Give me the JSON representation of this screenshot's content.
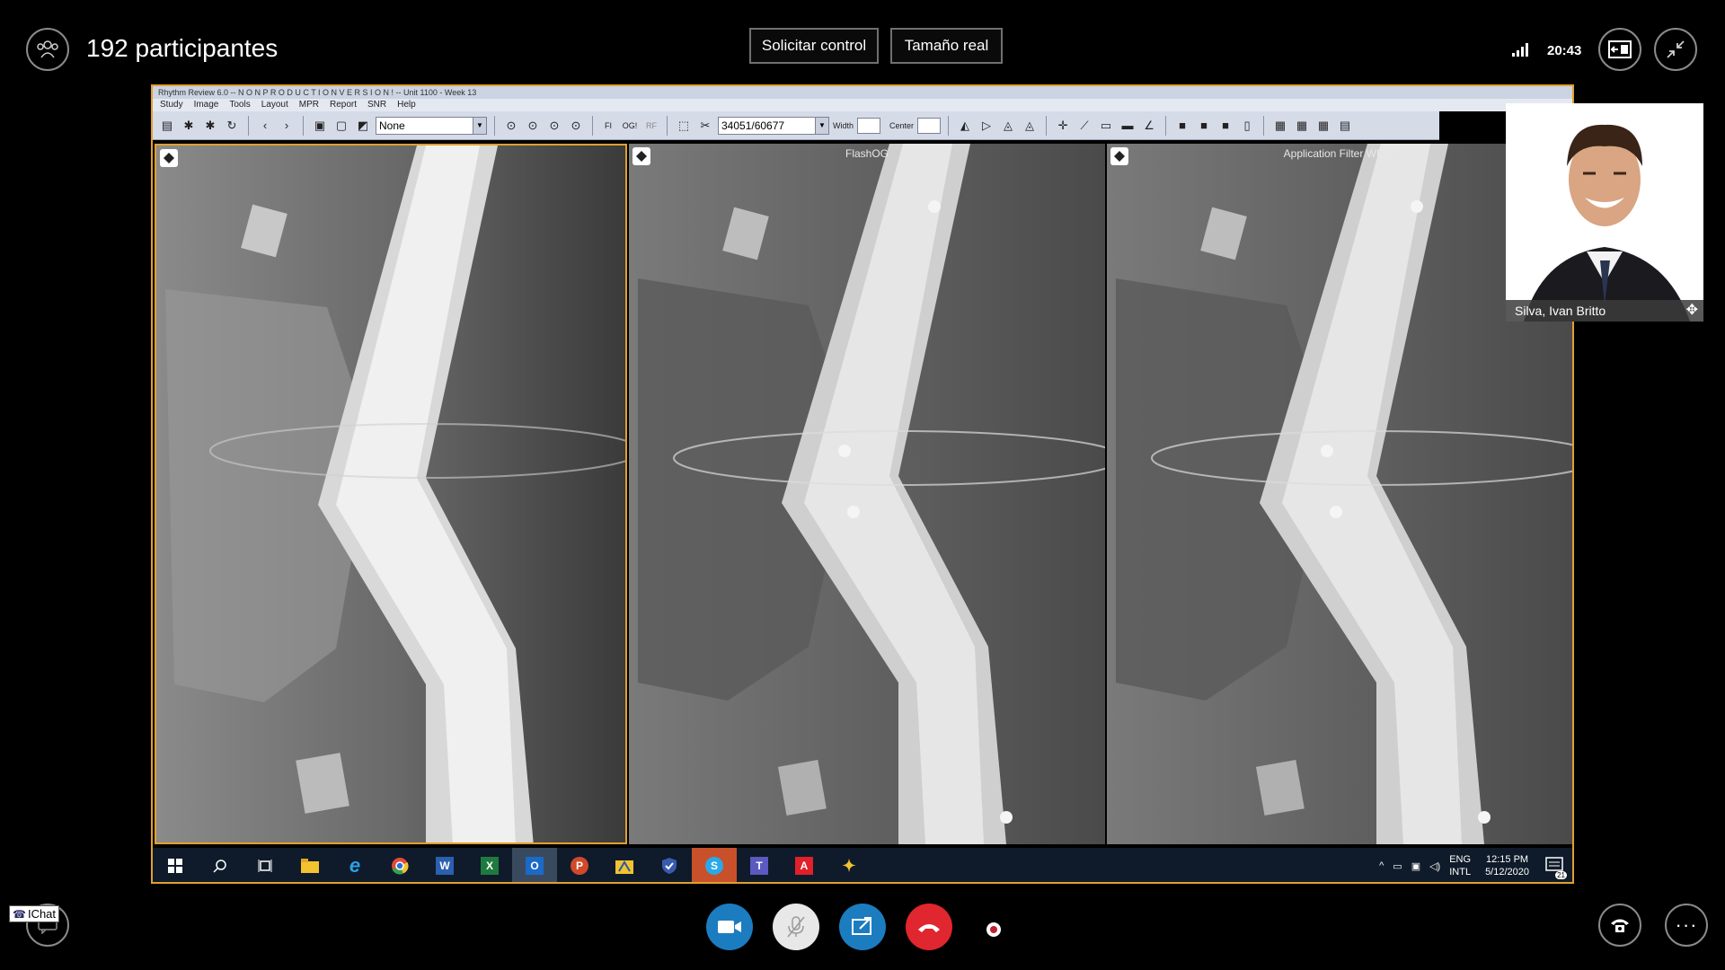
{
  "header": {
    "participants": "192 participantes",
    "request_control": "Solicitar control",
    "actual_size": "Tamaño real",
    "time": "20:43"
  },
  "app": {
    "title": "Rhythm Review 6.0 -- N O N   P R O D U C T I O N   V E R S I O N ! -- Unit 1100 - Week 13",
    "menu": [
      "Study",
      "Image",
      "Tools",
      "Layout",
      "MPR",
      "Report",
      "SNR",
      "Help"
    ],
    "preset_select": "None",
    "filter_labels": [
      "FI",
      "OG!",
      "RF"
    ],
    "image_select": "34051/60677",
    "width_label": "Width",
    "center_label": "Center",
    "panes": [
      {
        "label": ""
      },
      {
        "label": "FlashOG"
      },
      {
        "label": "Application Filter WELD"
      }
    ]
  },
  "taskbar": {
    "apps": [
      {
        "icon": "windows-start-icon",
        "active": false
      },
      {
        "icon": "search-icon",
        "active": false
      },
      {
        "icon": "task-view-icon",
        "active": false
      },
      {
        "icon": "file-explorer-icon",
        "active": false
      },
      {
        "icon": "internet-explorer-icon",
        "active": false
      },
      {
        "icon": "chrome-icon",
        "active": false
      },
      {
        "icon": "word-icon",
        "active": false
      },
      {
        "icon": "excel-icon",
        "active": false
      },
      {
        "icon": "outlook-icon",
        "active": true
      },
      {
        "icon": "powerpoint-icon",
        "active": false
      },
      {
        "icon": "folder-app-icon",
        "active": false
      },
      {
        "icon": "shield-app-icon",
        "active": false
      },
      {
        "icon": "skype-icon",
        "active": true
      },
      {
        "icon": "teams-icon",
        "active": false
      },
      {
        "icon": "acrobat-icon",
        "active": false
      },
      {
        "icon": "bulb-app-icon",
        "active": false
      }
    ],
    "lang_top": "ENG",
    "lang_bottom": "INTL",
    "clock_time": "12:15 PM",
    "clock_date": "5/12/2020",
    "notifications": "21"
  },
  "video_tile": {
    "name": "Silva, Ivan Britto"
  },
  "chat_badge": "IChat",
  "colors": {
    "share_border": "#e0a030",
    "video_btn": "#1c7cc0",
    "hangup_btn": "#e0262e"
  }
}
